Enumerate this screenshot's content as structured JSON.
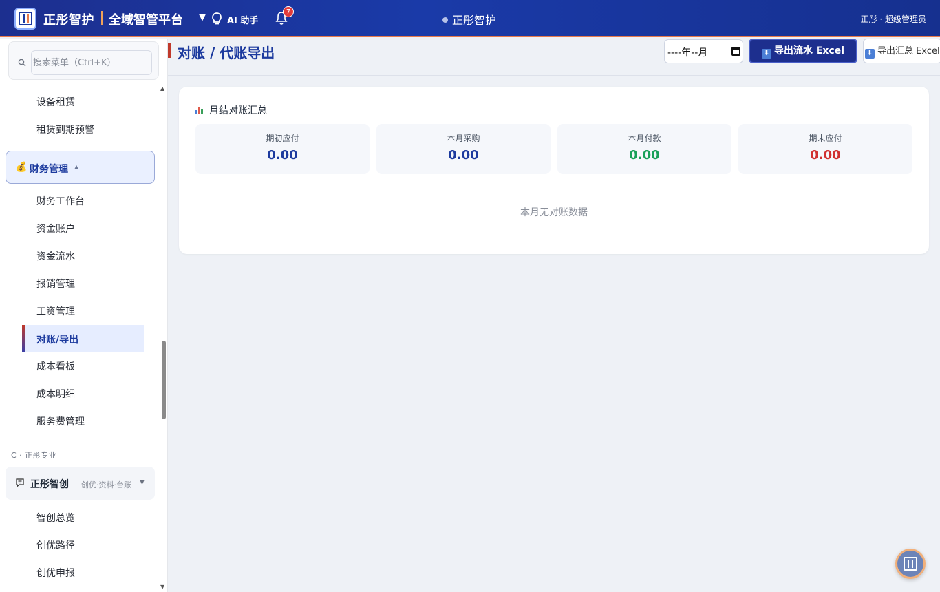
{
  "header": {
    "brand": "正彤智护",
    "platform": "全域智管平台",
    "ai_label": "AI 助手",
    "notification_count": "7",
    "center_title": "正彤智护",
    "user_info": "正彤 · 超级管理员"
  },
  "sidebar": {
    "search_placeholder": "搜索菜单（Ctrl+K）",
    "items_before": [
      "设备租赁",
      "租赁到期预警"
    ],
    "finance_group": {
      "icon": "💰",
      "label": "财务管理",
      "caret": "▲"
    },
    "finance_items": [
      "财务工作台",
      "资金账户",
      "资金流水",
      "报销管理",
      "工资管理",
      "对账/导出",
      "成本看板",
      "成本明细",
      "服务费管理"
    ],
    "active_item": "对账/导出",
    "section_label": "C · 正彤专业",
    "zc_group": {
      "label": "正彤智创",
      "sub": "创优·资料·台账",
      "caret": "▼"
    },
    "zc_items": [
      "智创总览",
      "创优路径",
      "创优申报"
    ]
  },
  "main": {
    "title": "对账 / 代账导出",
    "month_value": "----年--月",
    "export_flow_label": "导出流水 Excel",
    "export_summary_label": "导出汇总 Excel",
    "card_title": "月结对账汇总",
    "stats": [
      {
        "label": "期初应付",
        "value": "0.00",
        "color": "#1c3a9e"
      },
      {
        "label": "本月采购",
        "value": "0.00",
        "color": "#1c3a9e"
      },
      {
        "label": "本月付款",
        "value": "0.00",
        "color": "#18a058"
      },
      {
        "label": "期末应付",
        "value": "0.00",
        "color": "#d03030"
      }
    ],
    "empty_text": "本月无对账数据"
  },
  "colors": {
    "primary": "#1c3a9e",
    "accent": "#e8794a",
    "success": "#18a058",
    "danger": "#d03030"
  }
}
